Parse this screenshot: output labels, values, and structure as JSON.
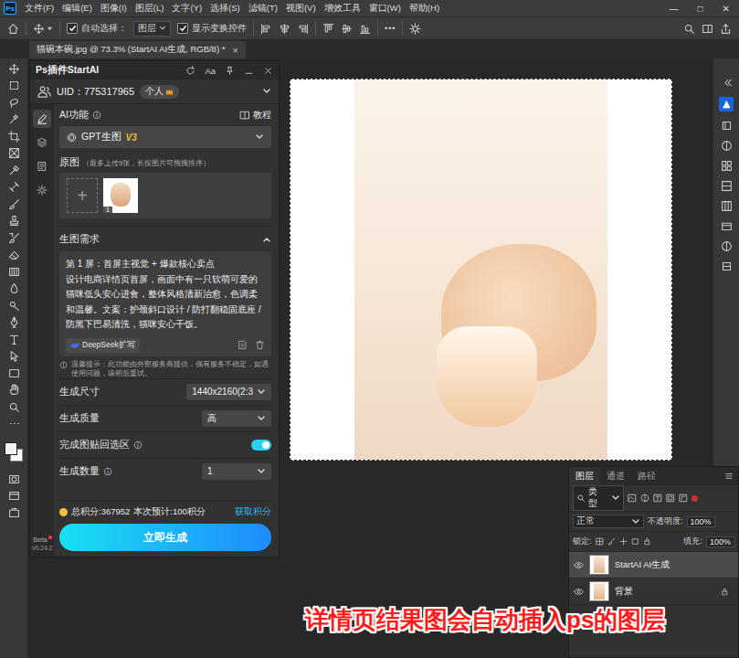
{
  "app": {
    "logo": "Ps"
  },
  "menu": [
    "文件(F)",
    "编辑(E)",
    "图像(I)",
    "图层(L)",
    "文字(Y)",
    "选择(S)",
    "滤镜(T)",
    "视图(V)",
    "增效工具",
    "窗口(W)",
    "帮助(H)"
  ],
  "window_controls": [
    "—",
    "□",
    "✕"
  ],
  "options_bar": {
    "auto_select": {
      "label": "自动选择：",
      "checked": true
    },
    "target": "图层",
    "show_transform": {
      "label": "显示变换控件",
      "checked": true
    },
    "more": "•••"
  },
  "document_tab": {
    "title": "猫碗本碗.jpg @ 73.3% (StartAI AI生成, RGB/8) *",
    "close": "×"
  },
  "plugin": {
    "title": "Ps插件StartAI",
    "font_button": "Aa",
    "uid": "UID：775317965",
    "plan": "个人",
    "nav": [
      {
        "kind": "edit",
        "selected": true
      },
      {
        "kind": "layers",
        "selected": false
      },
      {
        "kind": "document",
        "selected": false
      },
      {
        "kind": "settings",
        "selected": false
      }
    ],
    "ai_function": {
      "label": "AI功能",
      "tutorial": "教程"
    },
    "model": {
      "name": "GPT生图",
      "version": "V3"
    },
    "source": {
      "label": "原图",
      "hint": "（最多上传5张，长按图片可拖拽排序）",
      "add": "+",
      "images": [
        {
          "index": "1"
        }
      ]
    },
    "prompt": {
      "title": "生图需求",
      "expanded": true,
      "text": "第 1 屏：首屏主视觉 + 爆款核心卖点\n设计电商详情页首屏，画面中有一只软萌可爱的猫咪低头安心进食，整体风格清新治愈，色调柔和温馨。文案：护颈斜口设计 / 防打翻稳固底座 / 防黑下巴易清洗，猫咪安心干饭。",
      "expand_button": "DeepSeek扩写"
    },
    "notice": "温馨提示：此功能由外部服务商提供，偶有服务不稳定，如遇使用问题，请稍后重试。",
    "settings": [
      {
        "kind": "select",
        "label": "生成尺寸",
        "info": false,
        "value": "1440x2160(2:3"
      },
      {
        "kind": "select",
        "label": "生成质量",
        "info": false,
        "value": "高"
      },
      {
        "kind": "toggle",
        "label": "完成图贴回选区",
        "info": true,
        "on": true
      },
      {
        "kind": "select",
        "label": "生成数量",
        "info": true,
        "value": "1"
      }
    ],
    "points": {
      "total": "总积分:367952",
      "estimate": "本次预计:100积分",
      "get": "获取积分"
    },
    "generate": "立即生成",
    "version": {
      "badge": "Beta",
      "number": "V0.24.2"
    }
  },
  "layers_panel": {
    "tabs": [
      {
        "label": "图层",
        "selected": true
      },
      {
        "label": "通道",
        "selected": false
      },
      {
        "label": "路径",
        "selected": false
      }
    ],
    "filter": "类型",
    "blend": "正常",
    "opacity_label": "不透明度:",
    "opacity": "100%",
    "lock_label": "锁定:",
    "fill_label": "填充:",
    "fill": "100%",
    "layers": [
      {
        "name": "StartAI AI生成",
        "selected": true,
        "visible": true,
        "locked": false
      },
      {
        "name": "背景",
        "selected": false,
        "visible": true,
        "locked": true
      }
    ]
  },
  "caption": "详情页结果图会自动插入ps的图层"
}
